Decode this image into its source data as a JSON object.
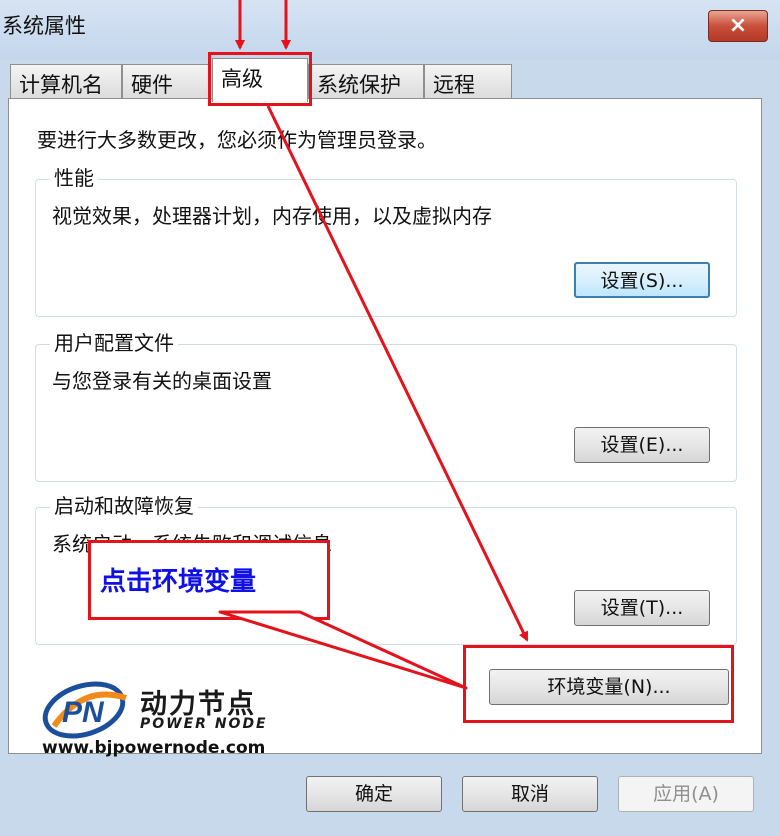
{
  "window": {
    "title": "系统属性",
    "close_icon": "×"
  },
  "tabs": [
    "计算机名",
    "硬件",
    "高级",
    "系统保护",
    "远程"
  ],
  "active_tab": "高级",
  "content": {
    "intro": "要进行大多数更改，您必须作为管理员登录。",
    "groups": [
      {
        "title": "性能",
        "desc": "视觉效果，处理器计划，内存使用，以及虚拟内存",
        "button": "设置(S)..."
      },
      {
        "title": "用户配置文件",
        "desc": "与您登录有关的桌面设置",
        "button": "设置(E)..."
      },
      {
        "title": "启动和故障恢复",
        "desc": "系统启动、系统失败和调试信息",
        "button": "设置(T)..."
      }
    ],
    "env_button": "环境变量(N)..."
  },
  "footer": {
    "ok": "确定",
    "cancel": "取消",
    "apply": "应用(A)"
  },
  "annotation": {
    "callout_text": "点击环境变量",
    "highlight_color": "#e3121b"
  },
  "watermark": {
    "name_cn": "动力节点",
    "name_en": "POWER NODE",
    "url": "www.bjpowernode.com",
    "logo_letters": "PN"
  }
}
